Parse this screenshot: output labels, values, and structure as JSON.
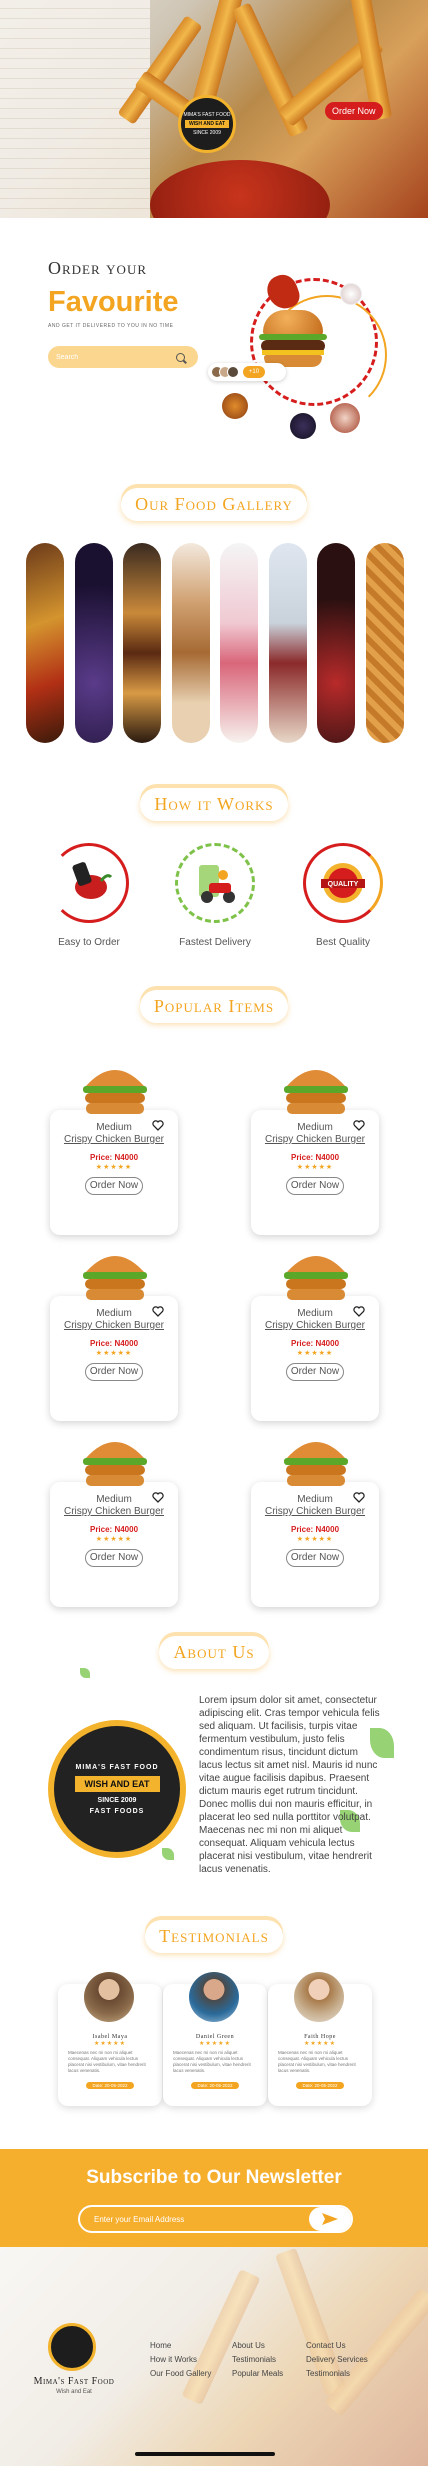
{
  "hero": {
    "order_now": "Order Now",
    "logo_line1": "MIMA'S FAST FOOD",
    "logo_line2": "WISH AND EAT",
    "logo_line3": "SINCE 2009"
  },
  "order": {
    "title": "Order your",
    "highlight": "Favourite",
    "subtitle": "AND GET IT DELIVERED TO YOU IN NO TIME",
    "search_placeholder": "Search",
    "mini_count": "+10"
  },
  "gallery": {
    "title": "Our Food Gallery",
    "images": [
      "pizza-slice",
      "blueberries",
      "burger",
      "onion-rings-burger",
      "strawberry-cake",
      "cupcakes",
      "cherry-dessert",
      "waffles"
    ]
  },
  "how": {
    "title": "How it Works",
    "steps": [
      {
        "label": "Easy to Order",
        "icon": "chili-phone-icon"
      },
      {
        "label": "Fastest Delivery",
        "icon": "delivery-scooter-icon"
      },
      {
        "label": "Best Quality",
        "icon": "quality-badge-icon"
      }
    ]
  },
  "popular": {
    "title": "Popular Items",
    "items": [
      {
        "size": "Medium",
        "name": "Crispy Chicken Burger",
        "price": "Price: N4000",
        "stars": "★★★★★",
        "button": "Order Now"
      },
      {
        "size": "Medium",
        "name": "Crispy Chicken Burger",
        "price": "Price: N4000",
        "stars": "★★★★★",
        "button": "Order Now"
      },
      {
        "size": "Medium",
        "name": "Crispy Chicken Burger",
        "price": "Price: N4000",
        "stars": "★★★★★",
        "button": "Order Now"
      },
      {
        "size": "Medium",
        "name": "Crispy Chicken Burger",
        "price": "Price: N4000",
        "stars": "★★★★★",
        "button": "Order Now"
      },
      {
        "size": "Medium",
        "name": "Crispy Chicken Burger",
        "price": "Price: N4000",
        "stars": "★★★★★",
        "button": "Order Now"
      },
      {
        "size": "Medium",
        "name": "Crispy Chicken Burger",
        "price": "Price: N4000",
        "stars": "★★★★★",
        "button": "Order Now"
      }
    ]
  },
  "about": {
    "title": "About Us",
    "badge_top": "MIMA'S FAST FOOD",
    "badge_strip": "WISH AND EAT",
    "badge_since": "SINCE 2009",
    "badge_bottom": "FAST FOODS",
    "text": "Lorem ipsum dolor sit amet, consectetur adipiscing elit. Cras tempor vehicula felis sed aliquam. Ut facilisis, turpis vitae fermentum vestibulum, justo felis condimentum risus, tincidunt dictum lacus lectus sit amet nisl. Mauris id nunc vitae augue facilisis dapibus. Praesent dictum mauris eget rutrum tincidunt. Donec mollis dui non mauris efficitur, in placerat leo sed nulla porttitor volutpat. Maecenas nec mi non mi aliquet consequat. Aliquam vehicula lectus placerat nisi vestibulum, vitae hendrerit lacus venenatis."
  },
  "testimonials": {
    "title": "Testimonials",
    "cards": [
      {
        "name": "Isabel Maya",
        "stars": "★★★★★",
        "body": "Maecenas nec mi non mi aliquet consequat. Aliquam vehicula lectus placerat nisi vestibulum, vitae hendrerit lacus venenatis.",
        "button": "Date: 20-05-2022"
      },
      {
        "name": "Daniel Green",
        "stars": "★★★★★",
        "body": "Maecenas nec mi non mi aliquet consequat. Aliquam vehicula lectus placerat nisi vestibulum, vitae hendrerit lacus venenatis.",
        "button": "Date: 20-05-2022"
      },
      {
        "name": "Faith Hope",
        "stars": "★★★★★",
        "body": "Maecenas nec mi non mi aliquet consequat. Aliquam vehicula lectus placerat nisi vestibulum, vitae hendrerit lacus venenatis.",
        "button": "Date: 20-05-2022"
      }
    ]
  },
  "newsletter": {
    "title": "Subscribe to Our Newsletter",
    "placeholder": "Enter your Email Address"
  },
  "footer": {
    "brand": "Mima's Fast Food",
    "tagline": "Wish and Eat",
    "col1": [
      "Home",
      "How it Works",
      "Our Food Gallery"
    ],
    "col2": [
      "About Us",
      "Testimonials",
      "Popular Meals"
    ],
    "col3": [
      "Contact Us",
      "Delivery Services",
      "Testimonials"
    ]
  },
  "colors": {
    "accent": "#f3a521",
    "red": "#d61d1d",
    "dark": "#1d1d1d"
  }
}
